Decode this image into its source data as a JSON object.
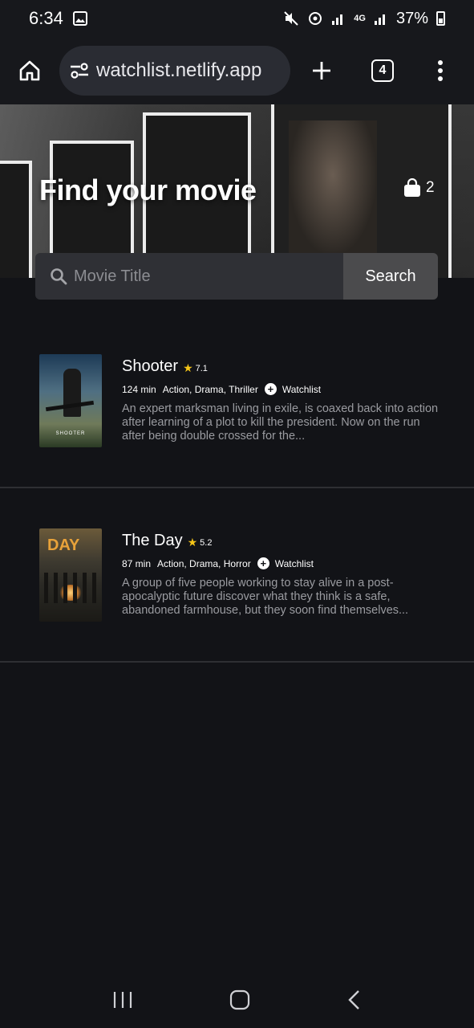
{
  "status_bar": {
    "time": "6:34",
    "network": "4G",
    "battery_pct": "37%"
  },
  "browser": {
    "url": "watchlist.netlify.app",
    "tab_count": "4"
  },
  "hero": {
    "title": "Find your movie",
    "watchlist_count": "2",
    "search": {
      "placeholder": "Movie Title",
      "value": "",
      "button_label": "Search"
    }
  },
  "movies": [
    {
      "title": "Shooter",
      "rating": "7.1",
      "runtime": "124 min",
      "genres": "Action, Drama, Thriller",
      "watchlist_label": "Watchlist",
      "description": "An expert marksman living in exile, is coaxed back into action after learning of a plot to kill the president. Now on the run after being double crossed for the...",
      "poster_text": "SHOOTER"
    },
    {
      "title": "The Day",
      "rating": "5.2",
      "runtime": "87 min",
      "genres": "Action, Drama, Horror",
      "watchlist_label": "Watchlist",
      "description": "A group of five people working to stay alive in a post-apocalyptic future discover what they think is a safe, abandoned farmhouse, but they soon find themselves...",
      "poster_text": "DAY"
    }
  ],
  "colors": {
    "background": "#121317",
    "star": "#f5c518",
    "search_button": "#4b4b4d"
  }
}
